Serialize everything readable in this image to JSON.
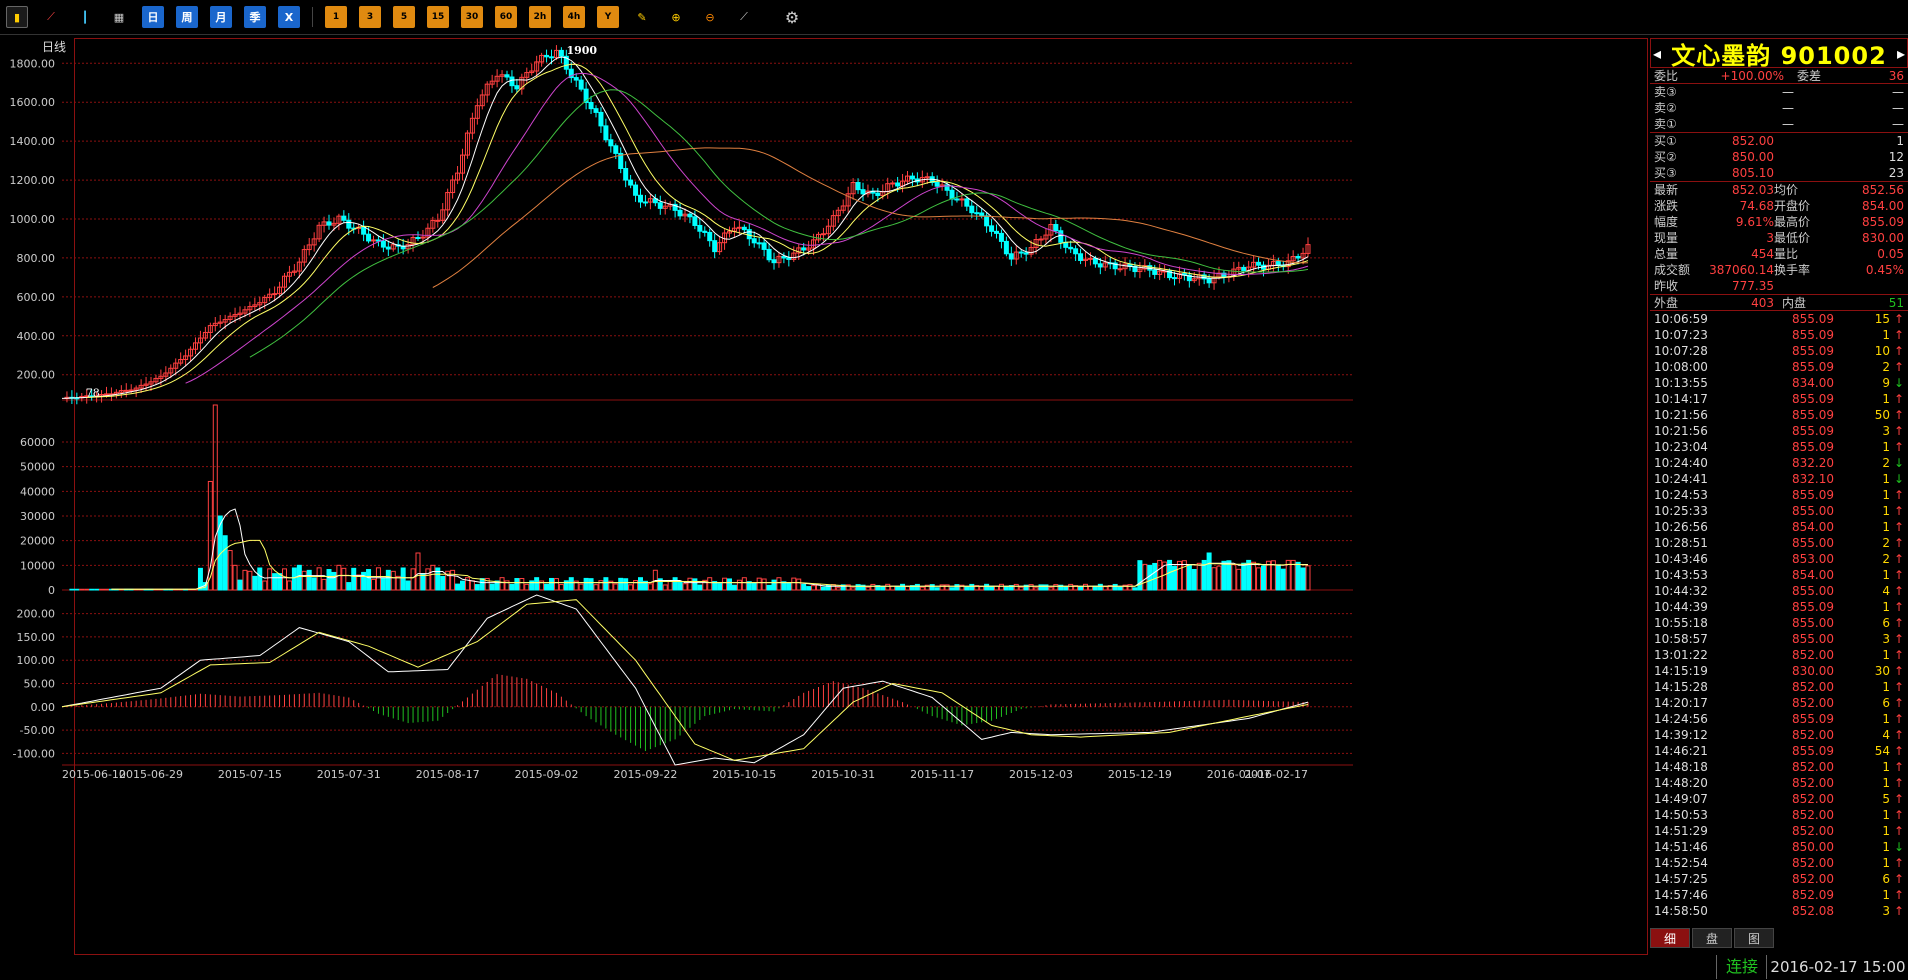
{
  "toolbar": {
    "period_buttons": [
      "日",
      "周",
      "月",
      "季",
      "X"
    ],
    "minute_buttons": [
      "1",
      "3",
      "5",
      "15",
      "30",
      "60",
      "2h",
      "4h",
      "Y"
    ]
  },
  "chart": {
    "period_label": "日线",
    "high_mark": "1900",
    "low_mark": "78"
  },
  "chart_data": [
    {
      "type": "line",
      "title": "",
      "subtitle": "candlestick with moving averages",
      "ylim": [
        70,
        1930
      ],
      "yticks": [
        200,
        400,
        600,
        800,
        1000,
        1200,
        1400,
        1600,
        1800
      ],
      "ytick_labels": [
        "200.00",
        "400.00",
        "600.00",
        "800.00",
        "1000.00",
        "1200.00",
        "1400.00",
        "1600.00",
        "1800.00"
      ],
      "x_labels": [
        "2015-06-10",
        "2015-06-29",
        "2015-07-15",
        "2015-07-31",
        "2015-08-17",
        "2015-09-02",
        "2015-09-22",
        "2015-10-15",
        "2015-10-31",
        "2015-11-17",
        "2015-12-03",
        "2015-12-19",
        "2016-01-07",
        "2016-02-17"
      ],
      "close_path": [
        [
          0,
          78
        ],
        [
          8,
          95
        ],
        [
          15,
          130
        ],
        [
          20,
          190
        ],
        [
          25,
          300
        ],
        [
          30,
          450
        ],
        [
          36,
          520
        ],
        [
          42,
          600
        ],
        [
          48,
          780
        ],
        [
          52,
          960
        ],
        [
          56,
          1000
        ],
        [
          60,
          940
        ],
        [
          64,
          870
        ],
        [
          68,
          850
        ],
        [
          72,
          900
        ],
        [
          76,
          1000
        ],
        [
          80,
          1250
        ],
        [
          84,
          1600
        ],
        [
          88,
          1750
        ],
        [
          92,
          1680
        ],
        [
          96,
          1810
        ],
        [
          100,
          1860
        ],
        [
          104,
          1700
        ],
        [
          108,
          1530
        ],
        [
          112,
          1320
        ],
        [
          116,
          1110
        ],
        [
          120,
          1080
        ],
        [
          124,
          1050
        ],
        [
          128,
          980
        ],
        [
          132,
          850
        ],
        [
          136,
          970
        ],
        [
          140,
          890
        ],
        [
          144,
          780
        ],
        [
          148,
          820
        ],
        [
          152,
          880
        ],
        [
          156,
          1000
        ],
        [
          160,
          1170
        ],
        [
          164,
          1120
        ],
        [
          168,
          1180
        ],
        [
          172,
          1210
        ],
        [
          176,
          1200
        ],
        [
          180,
          1120
        ],
        [
          184,
          1050
        ],
        [
          188,
          950
        ],
        [
          192,
          800
        ],
        [
          196,
          850
        ],
        [
          200,
          960
        ],
        [
          204,
          830
        ],
        [
          208,
          780
        ],
        [
          212,
          760
        ],
        [
          216,
          750
        ],
        [
          220,
          740
        ],
        [
          224,
          710
        ],
        [
          228,
          700
        ],
        [
          232,
          690
        ],
        [
          236,
          720
        ],
        [
          240,
          760
        ],
        [
          244,
          760
        ],
        [
          248,
          775
        ],
        [
          252,
          852
        ]
      ],
      "series": [
        {
          "name": "MA5",
          "color": "#ffffff"
        },
        {
          "name": "MA10",
          "color": "#ffff66"
        },
        {
          "name": "MA20",
          "color": "#cc44cc"
        },
        {
          "name": "MA30",
          "color": "#40c040"
        },
        {
          "name": "MA60",
          "color": "#e08040"
        }
      ]
    },
    {
      "type": "bar",
      "title": "",
      "subtitle": "volume",
      "ylim": [
        0,
        75000
      ],
      "yticks": [
        0,
        10000,
        20000,
        30000,
        40000,
        50000,
        60000
      ],
      "ytick_labels": [
        "0",
        "10000",
        "20000",
        "30000",
        "40000",
        "50000",
        "60000"
      ],
      "peaks": [
        [
          30,
          44000
        ],
        [
          31,
          75000
        ],
        [
          32,
          30000
        ],
        [
          33,
          22000
        ],
        [
          34,
          16000
        ],
        [
          35,
          10000
        ],
        [
          36,
          4000
        ],
        [
          48,
          10000
        ],
        [
          56,
          10000
        ],
        [
          72,
          15000
        ],
        [
          75,
          10000
        ],
        [
          120,
          8000
        ],
        [
          220,
          10000
        ],
        [
          224,
          12000
        ],
        [
          232,
          15000
        ],
        [
          240,
          12000
        ],
        [
          248,
          12000
        ]
      ]
    },
    {
      "type": "line",
      "title": "",
      "subtitle": "MACD",
      "ylim": [
        -125,
        240
      ],
      "yticks": [
        -100,
        -50,
        0,
        50,
        100,
        150,
        200
      ],
      "ytick_labels": [
        "-100.00",
        "-50.00",
        "0.00",
        "50.00",
        "100.00",
        "150.00",
        "200.00"
      ],
      "dif": [
        [
          0,
          0
        ],
        [
          20,
          40
        ],
        [
          28,
          100
        ],
        [
          40,
          110
        ],
        [
          48,
          170
        ],
        [
          58,
          140
        ],
        [
          66,
          75
        ],
        [
          78,
          80
        ],
        [
          86,
          190
        ],
        [
          96,
          240
        ],
        [
          104,
          210
        ],
        [
          116,
          40
        ],
        [
          124,
          -125
        ],
        [
          132,
          -110
        ],
        [
          140,
          -120
        ],
        [
          150,
          -60
        ],
        [
          158,
          40
        ],
        [
          166,
          55
        ],
        [
          176,
          20
        ],
        [
          186,
          -70
        ],
        [
          192,
          -55
        ],
        [
          200,
          -60
        ],
        [
          220,
          -55
        ],
        [
          240,
          -25
        ],
        [
          252,
          10
        ]
      ],
      "dea": [
        [
          0,
          0
        ],
        [
          20,
          30
        ],
        [
          30,
          90
        ],
        [
          42,
          95
        ],
        [
          52,
          160
        ],
        [
          62,
          130
        ],
        [
          72,
          85
        ],
        [
          84,
          140
        ],
        [
          94,
          220
        ],
        [
          104,
          230
        ],
        [
          116,
          100
        ],
        [
          128,
          -80
        ],
        [
          136,
          -115
        ],
        [
          150,
          -90
        ],
        [
          160,
          10
        ],
        [
          168,
          50
        ],
        [
          178,
          30
        ],
        [
          188,
          -40
        ],
        [
          196,
          -60
        ],
        [
          206,
          -65
        ],
        [
          224,
          -55
        ],
        [
          240,
          -20
        ],
        [
          252,
          5
        ]
      ],
      "histogram": [
        [
          0,
          0
        ],
        [
          10,
          8
        ],
        [
          20,
          18
        ],
        [
          28,
          28
        ],
        [
          36,
          22
        ],
        [
          44,
          25
        ],
        [
          52,
          30
        ],
        [
          58,
          20
        ],
        [
          64,
          -15
        ],
        [
          70,
          -35
        ],
        [
          76,
          -30
        ],
        [
          82,
          20
        ],
        [
          88,
          70
        ],
        [
          94,
          60
        ],
        [
          100,
          30
        ],
        [
          106,
          -20
        ],
        [
          112,
          -60
        ],
        [
          118,
          -95
        ],
        [
          124,
          -70
        ],
        [
          130,
          -20
        ],
        [
          136,
          -5
        ],
        [
          144,
          -10
        ],
        [
          150,
          30
        ],
        [
          156,
          55
        ],
        [
          162,
          40
        ],
        [
          170,
          10
        ],
        [
          176,
          -20
        ],
        [
          182,
          -40
        ],
        [
          188,
          -30
        ],
        [
          194,
          -5
        ],
        [
          200,
          5
        ],
        [
          220,
          10
        ],
        [
          236,
          15
        ],
        [
          252,
          10
        ]
      ]
    }
  ],
  "quote_panel": {
    "title_left_arrow": "◂",
    "title_name": "文心墨韵 901002",
    "title_right_arrow": "▸",
    "weibi_label": "委比",
    "weibi_value": "+100.00%",
    "weicha_label": "委差",
    "weicha_value": "36",
    "asks": [
      {
        "label": "卖③",
        "price": "—",
        "vol": "—"
      },
      {
        "label": "卖②",
        "price": "—",
        "vol": "—"
      },
      {
        "label": "卖①",
        "price": "—",
        "vol": "—"
      }
    ],
    "bids": [
      {
        "label": "买①",
        "price": "852.00",
        "vol": "1"
      },
      {
        "label": "买②",
        "price": "850.00",
        "vol": "12"
      },
      {
        "label": "买③",
        "price": "805.10",
        "vol": "23"
      }
    ],
    "stats": [
      {
        "l1": "最新",
        "v1": "852.03",
        "l2": "均价",
        "v2": "852.56"
      },
      {
        "l1": "涨跌",
        "v1": "74.68",
        "l2": "开盘价",
        "v2": "854.00"
      },
      {
        "l1": "幅度",
        "v1": "9.61%",
        "l2": "最高价",
        "v2": "855.09"
      },
      {
        "l1": "现量",
        "v1": "3",
        "l2": "最低价",
        "v2": "830.00"
      },
      {
        "l1": "总量",
        "v1": "454",
        "l2": "量比",
        "v2": "0.05"
      },
      {
        "l1": "成交额",
        "v1": "387060.14",
        "l2": "换手率",
        "v2": "0.45%"
      },
      {
        "l1": "昨收",
        "v1": "777.35",
        "l2": "",
        "v2": ""
      }
    ],
    "outer_label": "外盘",
    "outer_value": "403",
    "inner_label": "内盘",
    "inner_value": "51",
    "ticks": [
      {
        "t": "10:06:59",
        "p": "855.09",
        "v": "15",
        "d": "↑"
      },
      {
        "t": "10:07:23",
        "p": "855.09",
        "v": "1",
        "d": "↑"
      },
      {
        "t": "10:07:28",
        "p": "855.09",
        "v": "10",
        "d": "↑"
      },
      {
        "t": "10:08:00",
        "p": "855.09",
        "v": "2",
        "d": "↑"
      },
      {
        "t": "10:13:55",
        "p": "834.00",
        "v": "9",
        "d": "↓"
      },
      {
        "t": "10:14:17",
        "p": "855.09",
        "v": "1",
        "d": "↑"
      },
      {
        "t": "10:21:56",
        "p": "855.09",
        "v": "50",
        "d": "↑"
      },
      {
        "t": "10:21:56",
        "p": "855.09",
        "v": "3",
        "d": "↑"
      },
      {
        "t": "10:23:04",
        "p": "855.09",
        "v": "1",
        "d": "↑"
      },
      {
        "t": "10:24:40",
        "p": "832.20",
        "v": "2",
        "d": "↓"
      },
      {
        "t": "10:24:41",
        "p": "832.10",
        "v": "1",
        "d": "↓"
      },
      {
        "t": "10:24:53",
        "p": "855.09",
        "v": "1",
        "d": "↑"
      },
      {
        "t": "10:25:33",
        "p": "855.00",
        "v": "1",
        "d": "↑"
      },
      {
        "t": "10:26:56",
        "p": "854.00",
        "v": "1",
        "d": "↑"
      },
      {
        "t": "10:28:51",
        "p": "855.00",
        "v": "2",
        "d": "↑"
      },
      {
        "t": "10:43:46",
        "p": "853.00",
        "v": "2",
        "d": "↑"
      },
      {
        "t": "10:43:53",
        "p": "854.00",
        "v": "1",
        "d": "↑"
      },
      {
        "t": "10:44:32",
        "p": "855.00",
        "v": "4",
        "d": "↑"
      },
      {
        "t": "10:44:39",
        "p": "855.09",
        "v": "1",
        "d": "↑"
      },
      {
        "t": "10:55:18",
        "p": "855.00",
        "v": "6",
        "d": "↑"
      },
      {
        "t": "10:58:57",
        "p": "855.00",
        "v": "3",
        "d": "↑"
      },
      {
        "t": "13:01:22",
        "p": "852.00",
        "v": "1",
        "d": "↑"
      },
      {
        "t": "14:15:19",
        "p": "830.00",
        "v": "30",
        "d": "↑"
      },
      {
        "t": "14:15:28",
        "p": "852.00",
        "v": "1",
        "d": "↑"
      },
      {
        "t": "14:20:17",
        "p": "852.00",
        "v": "6",
        "d": "↑"
      },
      {
        "t": "14:24:56",
        "p": "855.09",
        "v": "1",
        "d": "↑"
      },
      {
        "t": "14:39:12",
        "p": "852.00",
        "v": "4",
        "d": "↑"
      },
      {
        "t": "14:46:21",
        "p": "855.09",
        "v": "54",
        "d": "↑"
      },
      {
        "t": "14:48:18",
        "p": "852.00",
        "v": "1",
        "d": "↑"
      },
      {
        "t": "14:48:20",
        "p": "852.00",
        "v": "1",
        "d": "↑"
      },
      {
        "t": "14:49:07",
        "p": "852.00",
        "v": "5",
        "d": "↑"
      },
      {
        "t": "14:50:53",
        "p": "852.00",
        "v": "1",
        "d": "↑"
      },
      {
        "t": "14:51:29",
        "p": "852.00",
        "v": "1",
        "d": "↑"
      },
      {
        "t": "14:51:46",
        "p": "850.00",
        "v": "1",
        "d": "↓"
      },
      {
        "t": "14:52:54",
        "p": "852.00",
        "v": "1",
        "d": "↑"
      },
      {
        "t": "14:57:25",
        "p": "852.00",
        "v": "6",
        "d": "↑"
      },
      {
        "t": "14:57:46",
        "p": "852.09",
        "v": "1",
        "d": "↑"
      },
      {
        "t": "14:58:50",
        "p": "852.08",
        "v": "3",
        "d": "↑"
      }
    ],
    "tabs": [
      "细",
      "盘",
      "图"
    ]
  },
  "status": {
    "connection": "连接",
    "datetime": "2016-02-17 15:00"
  },
  "colors": {
    "up": "#ff4040",
    "down": "#00ffff",
    "grid": "#8b1010",
    "accent": "#ffd700"
  }
}
